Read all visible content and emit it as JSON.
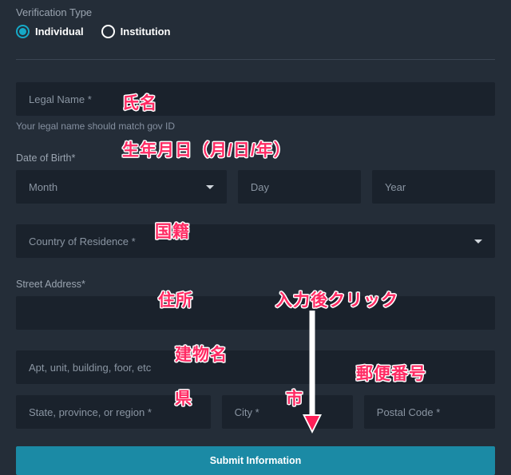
{
  "section_title": "Verification Type",
  "radios": {
    "individual": "Individual",
    "institution": "Institution"
  },
  "legal_name": {
    "placeholder": "Legal Name *",
    "helper": "Your legal name should match gov ID"
  },
  "dob": {
    "label": "Date of Birth*",
    "month_placeholder": "Month",
    "day_placeholder": "Day",
    "year_placeholder": "Year"
  },
  "country": {
    "placeholder": "Country of Residence *"
  },
  "street": {
    "label": "Street Address*",
    "apt_placeholder": "Apt, unit, building, foor, etc"
  },
  "region_placeholder": "State, province, or region *",
  "city_placeholder": "City *",
  "postal_placeholder": "Postal Code *",
  "submit_label": "Submit Information",
  "anno": {
    "name": "氏名",
    "dob": "生年月日（月/日/年）",
    "country": "国籍",
    "address": "住所",
    "building": "建物名",
    "pref": "県",
    "city": "市",
    "postal": "郵便番号",
    "after_input_click": "入力後クリック"
  }
}
